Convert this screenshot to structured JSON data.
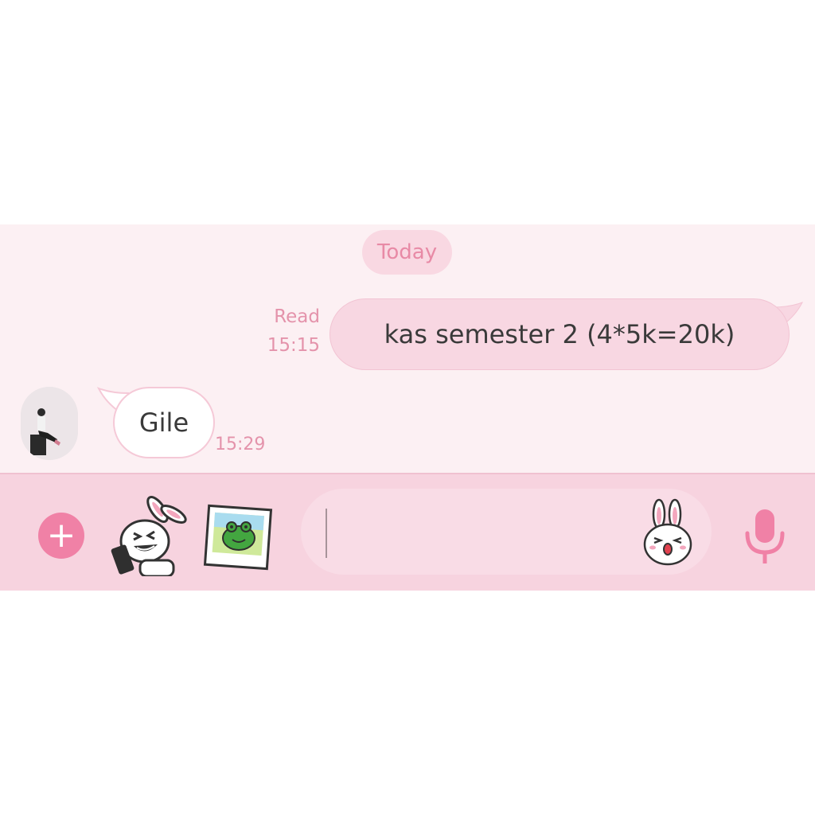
{
  "chat": {
    "date_label": "Today",
    "outgoing": {
      "status": "Read",
      "time": "15:15",
      "text": "kas semester 2 (4*5k=20k)"
    },
    "incoming": {
      "text": "Gile",
      "time": "15:29"
    }
  },
  "input_bar": {
    "plus_symbol": "+",
    "message_value": ""
  },
  "icons": {
    "add": "plus-circle-icon",
    "sticker": "bunny-sticker-icon",
    "gallery": "photo-sticker-icon",
    "emoji": "bunny-face-emoji-icon",
    "voice": "microphone-icon"
  },
  "colors": {
    "chat_background": "#fcf0f3",
    "outgoing_bubble": "#f8d7e2",
    "incoming_bubble": "#ffffff",
    "input_bar": "#f7d3df",
    "accent": "#f081a6",
    "meta_text": "#e493ab"
  }
}
